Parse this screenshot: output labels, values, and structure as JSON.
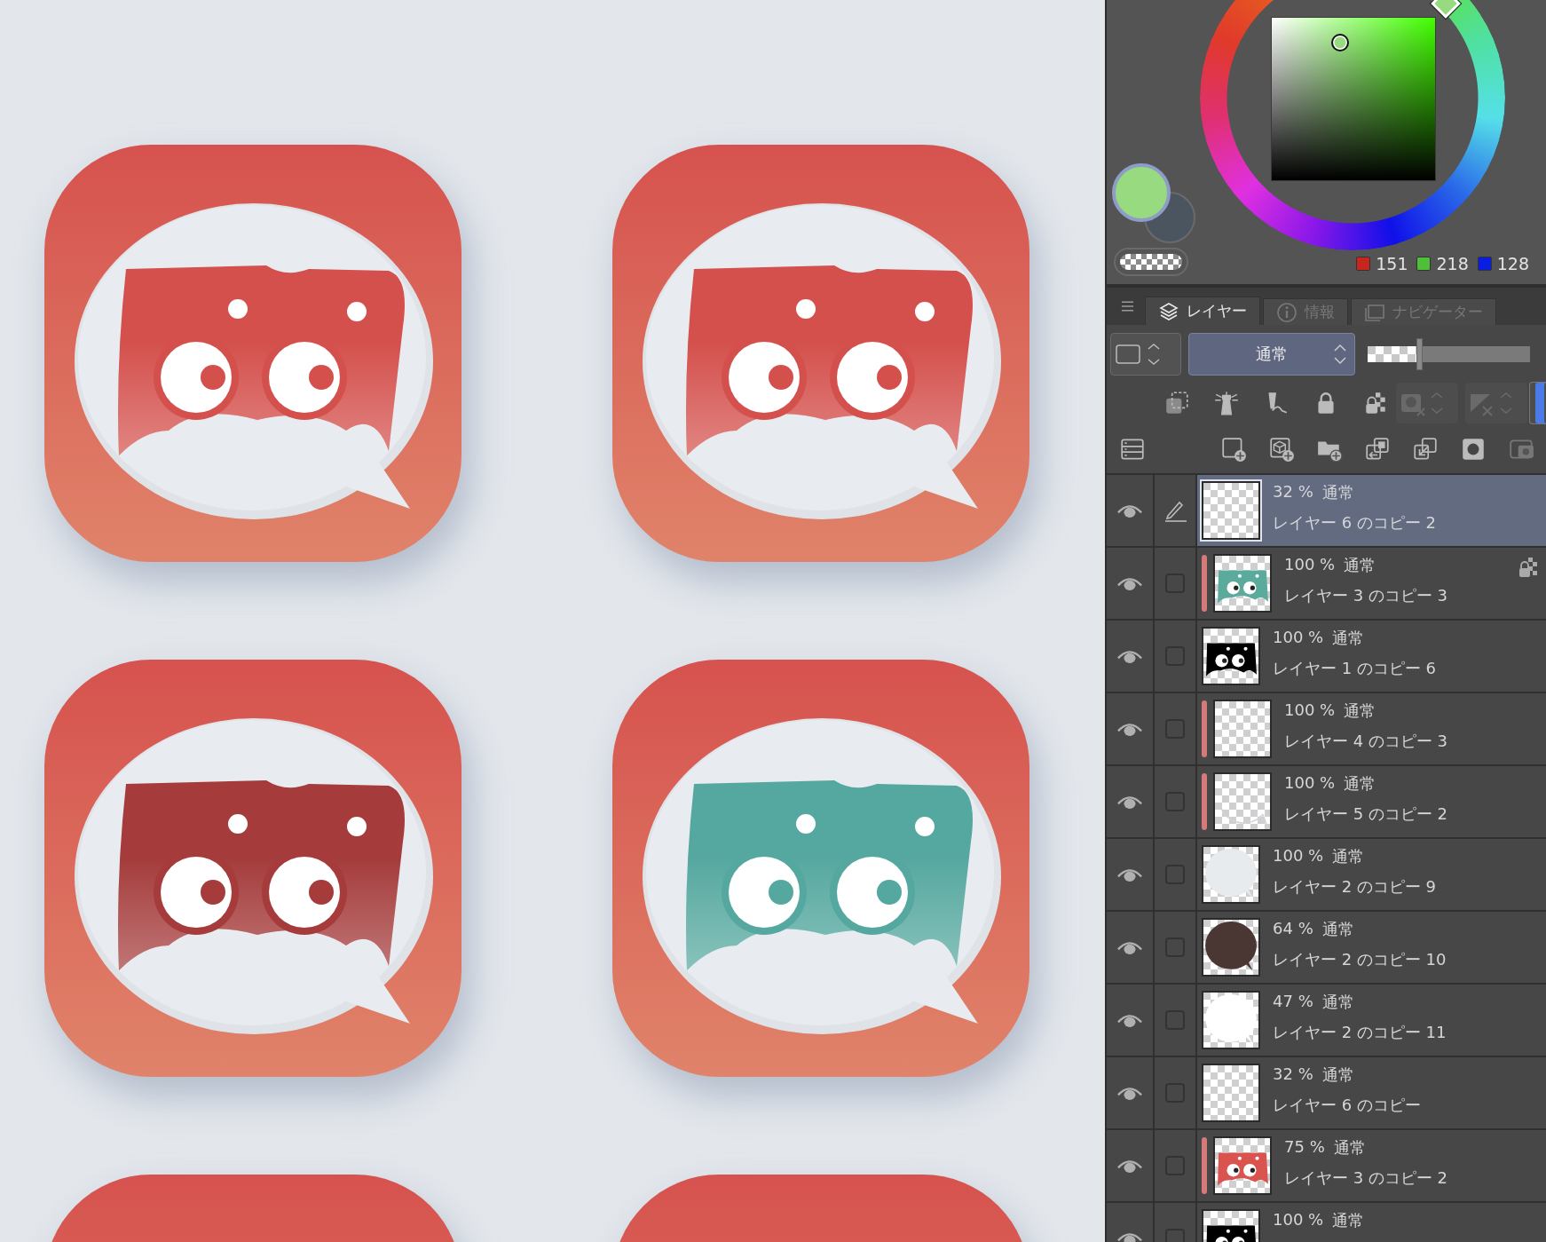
{
  "canvas": {
    "icons": [
      {
        "kind": "full",
        "color": "#d4504c"
      },
      {
        "kind": "full",
        "color": "#d4504c"
      },
      {
        "kind": "full",
        "color": "#a53b3b"
      },
      {
        "kind": "full",
        "color": "#55a89f"
      },
      {
        "kind": "cropped"
      },
      {
        "kind": "cropped"
      }
    ]
  },
  "color_panel": {
    "rgb": [
      "151",
      "218",
      "128"
    ]
  },
  "layer_panel": {
    "tabs": [
      {
        "label": "レイヤー",
        "selected": true
      },
      {
        "label": "情報",
        "selected": false
      },
      {
        "label": "ナビゲーター",
        "selected": false
      }
    ],
    "blend_mode": "通常",
    "opacity": {
      "level": 0.31
    },
    "mask_display": {
      "disabled": true
    },
    "ruler_display": {
      "disabled": true
    },
    "layers": [
      {
        "visible": true,
        "selected": true,
        "clipped": false,
        "locked_transparency": false,
        "thumbnail": {
          "kind": "blank"
        },
        "opacity": "32 %",
        "blend": "通常",
        "name": "レイヤー 6 のコピー 2"
      },
      {
        "visible": true,
        "selected": false,
        "checked": false,
        "clipped": true,
        "locked_transparency": true,
        "thumbnail": {
          "kind": "mascot",
          "color": "#5aab9c"
        },
        "opacity": "100 %",
        "blend": "通常",
        "name": "レイヤー 3 のコピー 3"
      },
      {
        "visible": true,
        "selected": false,
        "checked": false,
        "clipped": false,
        "locked_transparency": false,
        "thumbnail": {
          "kind": "mascot",
          "color": "#000000"
        },
        "opacity": "100 %",
        "blend": "通常",
        "name": "レイヤー 1 のコピー 6"
      },
      {
        "visible": true,
        "selected": false,
        "checked": false,
        "clipped": true,
        "locked_transparency": false,
        "thumbnail": {
          "kind": "blank"
        },
        "opacity": "100 %",
        "blend": "通常",
        "name": "レイヤー 4 のコピー 3"
      },
      {
        "visible": true,
        "selected": false,
        "checked": false,
        "clipped": true,
        "locked_transparency": false,
        "thumbnail": {
          "kind": "outline"
        },
        "opacity": "100 %",
        "blend": "通常",
        "name": "レイヤー 5 のコピー 2"
      },
      {
        "visible": true,
        "selected": false,
        "checked": false,
        "clipped": false,
        "locked_transparency": false,
        "thumbnail": {
          "kind": "bubble",
          "color": "#e8ebee"
        },
        "opacity": "100 %",
        "blend": "通常",
        "name": "レイヤー 2 のコピー 9"
      },
      {
        "visible": true,
        "selected": false,
        "checked": false,
        "clipped": false,
        "locked_transparency": false,
        "thumbnail": {
          "kind": "bubble",
          "color": "#4a3632"
        },
        "opacity": "64 %",
        "blend": "通常",
        "name": "レイヤー 2 のコピー 10"
      },
      {
        "visible": true,
        "selected": false,
        "checked": false,
        "clipped": false,
        "locked_transparency": false,
        "thumbnail": {
          "kind": "bubble",
          "color": "#ffffff"
        },
        "opacity": "47 %",
        "blend": "通常",
        "name": "レイヤー 2 のコピー 11"
      },
      {
        "visible": true,
        "selected": false,
        "checked": false,
        "clipped": false,
        "locked_transparency": false,
        "thumbnail": {
          "kind": "blank"
        },
        "opacity": "32 %",
        "blend": "通常",
        "name": "レイヤー 6 のコピー"
      },
      {
        "visible": true,
        "selected": false,
        "checked": false,
        "clipped": true,
        "locked_transparency": false,
        "thumbnail": {
          "kind": "mascot",
          "color": "#d9534f"
        },
        "opacity": "75 %",
        "blend": "通常",
        "name": "レイヤー 3 のコピー 2"
      },
      {
        "visible": true,
        "selected": false,
        "checked": false,
        "clipped": false,
        "locked_transparency": false,
        "thumbnail": {
          "kind": "mascot",
          "color": "#000000"
        },
        "opacity": "100 %",
        "blend": "通常"
      }
    ]
  }
}
